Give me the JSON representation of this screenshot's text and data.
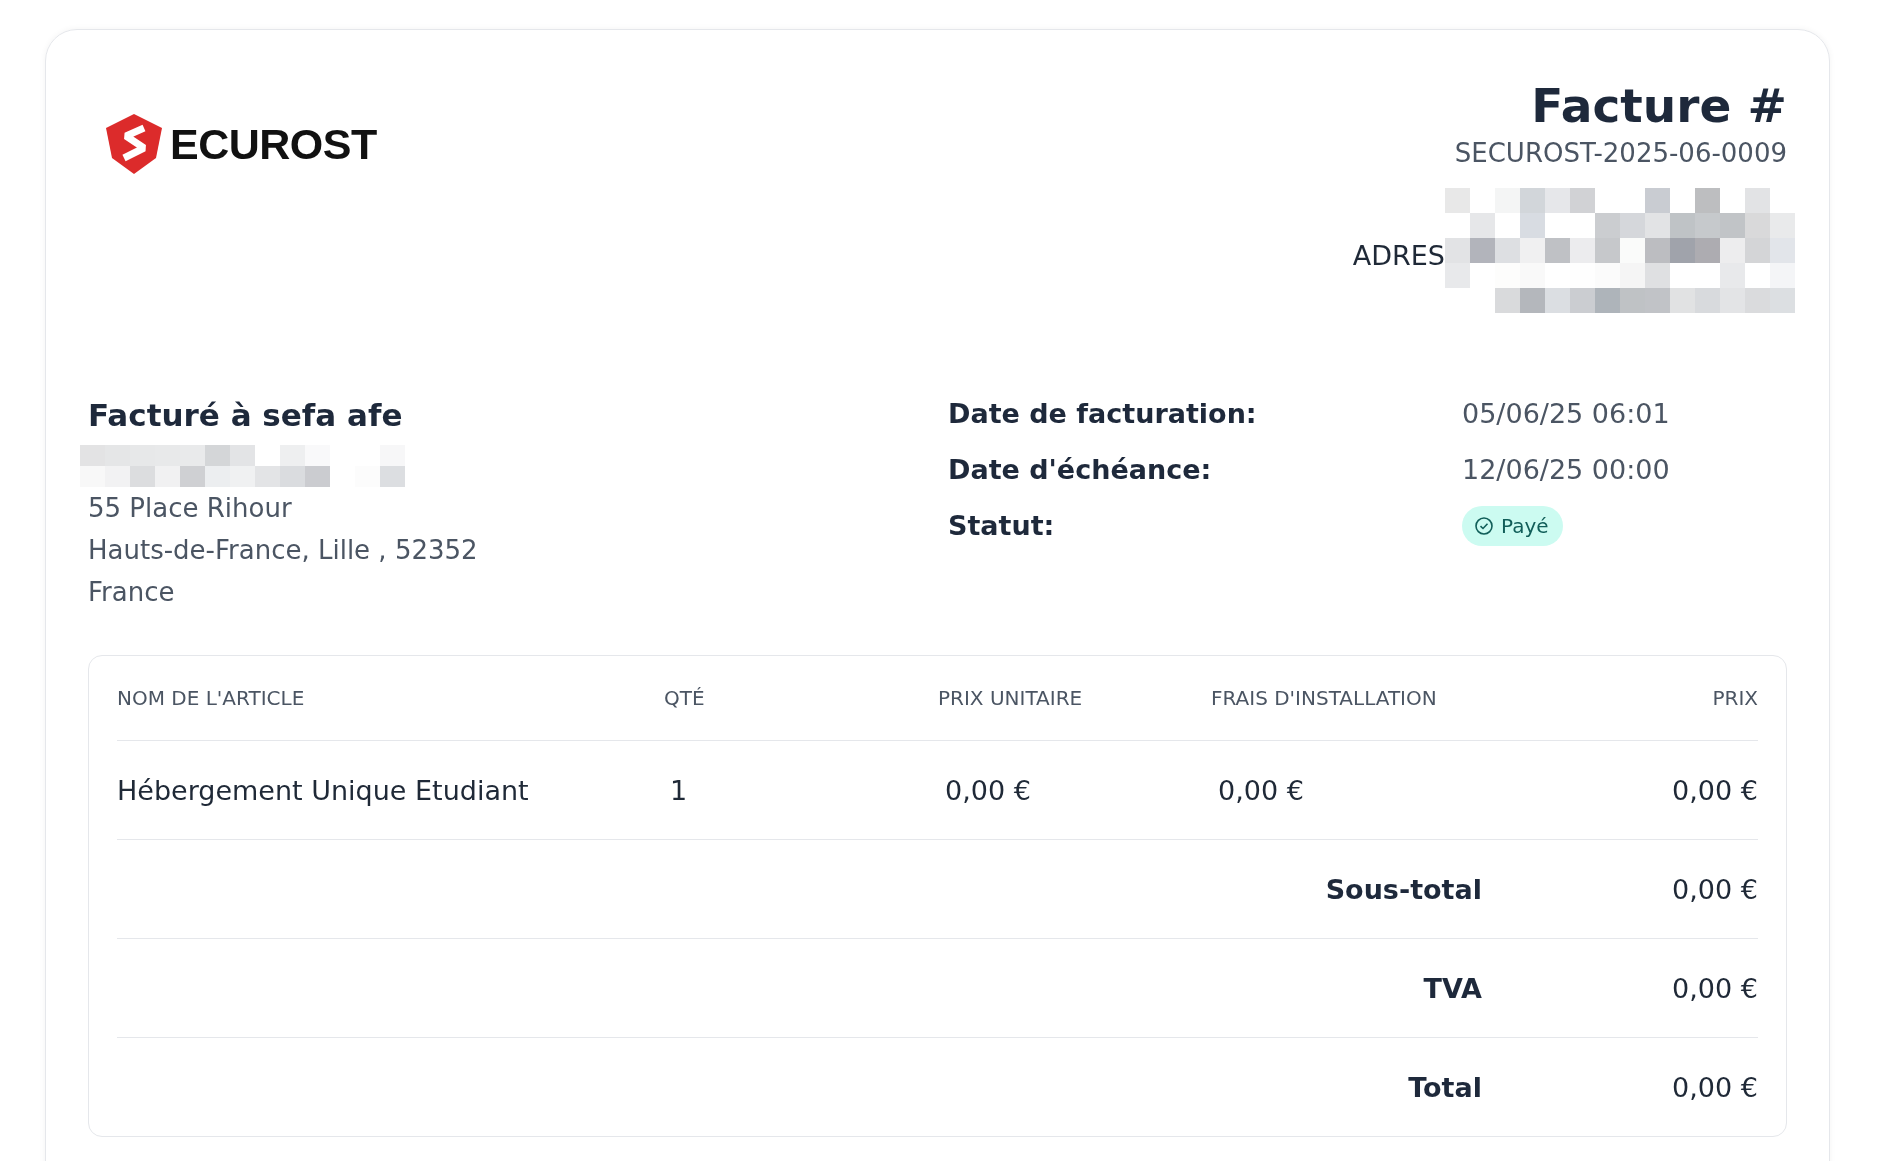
{
  "brand": {
    "name": "ECUROST"
  },
  "invoice": {
    "title": "Facture #",
    "number": "SECUROST-2025-06-0009",
    "address_label": "ADRES"
  },
  "billed_to": {
    "heading": "Facturé à sefa afe",
    "lines": [
      "55 Place Rihour",
      "Hauts-de-France, Lille , 52352",
      "France"
    ]
  },
  "details": [
    {
      "label": "Date de facturation:",
      "value": "05/06/25 06:01"
    },
    {
      "label": "Date d'échéance:",
      "value": "12/06/25 00:00"
    }
  ],
  "status": {
    "label": "Statut:",
    "value": "Payé",
    "kind": "paid"
  },
  "table": {
    "columns": [
      "NOM DE L'ARTICLE",
      "QTÉ",
      "PRIX UNITAIRE",
      "FRAIS D'INSTALLATION",
      "PRIX"
    ],
    "rows": [
      [
        "Hébergement Unique Etudiant",
        "1",
        "0,00 €",
        "0,00 €",
        "0,00 €"
      ]
    ],
    "totals": [
      {
        "label": "Sous-total",
        "value": "0,00 €"
      },
      {
        "label": "TVA",
        "value": "0,00 €"
      },
      {
        "label": "Total",
        "value": "0,00 €"
      }
    ]
  }
}
